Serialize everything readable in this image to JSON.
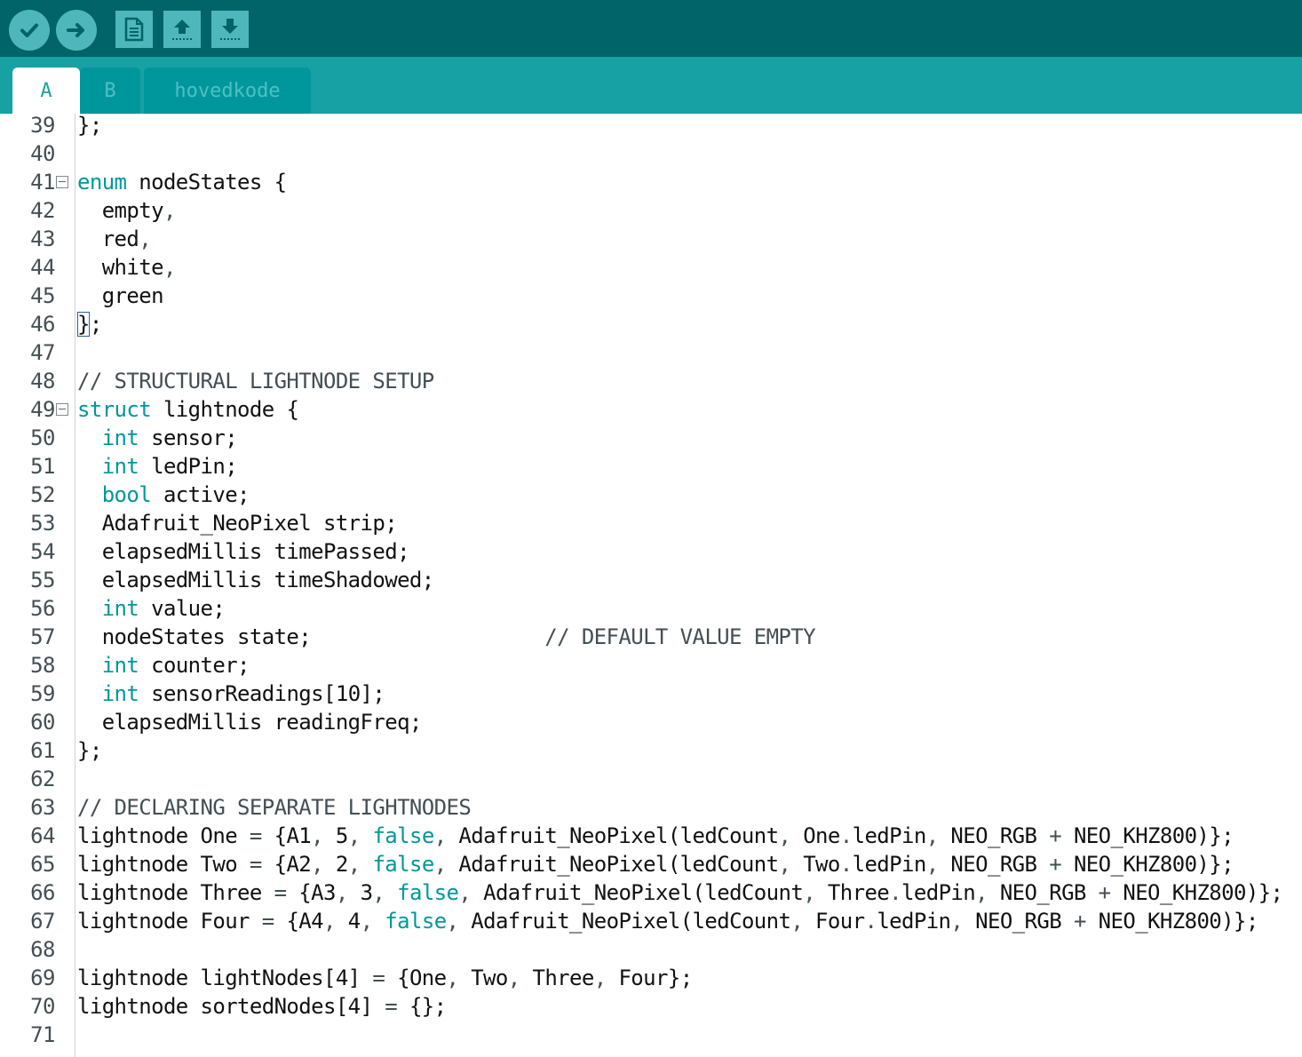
{
  "toolbar": {
    "buttons": [
      {
        "name": "verify-button",
        "icon": "checkmark-icon",
        "shape": "round"
      },
      {
        "name": "upload-button",
        "icon": "arrow-right-icon",
        "shape": "round"
      },
      {
        "name": "new-button",
        "icon": "new-document-icon",
        "shape": "square"
      },
      {
        "name": "open-button",
        "icon": "arrow-up-icon",
        "shape": "square"
      },
      {
        "name": "save-button",
        "icon": "arrow-down-icon",
        "shape": "square"
      }
    ]
  },
  "tabs": [
    {
      "label": "A",
      "active": true
    },
    {
      "label": "B",
      "active": false
    },
    {
      "label": "hovedkode",
      "active": false
    }
  ],
  "colors": {
    "toolbar_bg": "#006468",
    "tabbar_bg": "#17a1a5",
    "keyword": "#00979c",
    "comment": "#434f54"
  },
  "editor": {
    "lines": [
      {
        "n": "39",
        "segments": [
          [
            "t",
            "};"
          ]
        ]
      },
      {
        "n": "40",
        "segments": []
      },
      {
        "n": "41",
        "fold": true,
        "segments": [
          [
            "k",
            "enum"
          ],
          [
            "t",
            " nodeStates {"
          ]
        ]
      },
      {
        "n": "42",
        "segments": [
          [
            "t",
            "  empty"
          ],
          [
            "p",
            ","
          ]
        ]
      },
      {
        "n": "43",
        "segments": [
          [
            "t",
            "  red"
          ],
          [
            "p",
            ","
          ]
        ]
      },
      {
        "n": "44",
        "segments": [
          [
            "t",
            "  white"
          ],
          [
            "p",
            ","
          ]
        ]
      },
      {
        "n": "45",
        "segments": [
          [
            "t",
            "  green"
          ]
        ]
      },
      {
        "n": "46",
        "segments": [
          [
            "b",
            "}"
          ],
          [
            "t",
            ";"
          ]
        ]
      },
      {
        "n": "47",
        "segments": []
      },
      {
        "n": "48",
        "segments": [
          [
            "c",
            "// STRUCTURAL LIGHTNODE SETUP"
          ]
        ]
      },
      {
        "n": "49",
        "fold": true,
        "segments": [
          [
            "k",
            "struct"
          ],
          [
            "t",
            " lightnode {"
          ]
        ]
      },
      {
        "n": "50",
        "segments": [
          [
            "t",
            "  "
          ],
          [
            "k",
            "int"
          ],
          [
            "t",
            " sensor;"
          ]
        ]
      },
      {
        "n": "51",
        "segments": [
          [
            "t",
            "  "
          ],
          [
            "k",
            "int"
          ],
          [
            "t",
            " ledPin;"
          ]
        ]
      },
      {
        "n": "52",
        "segments": [
          [
            "t",
            "  "
          ],
          [
            "k",
            "bool"
          ],
          [
            "t",
            " active;"
          ]
        ]
      },
      {
        "n": "53",
        "segments": [
          [
            "t",
            "  Adafruit_NeoPixel strip;"
          ]
        ]
      },
      {
        "n": "54",
        "segments": [
          [
            "t",
            "  elapsedMillis timePassed;"
          ]
        ]
      },
      {
        "n": "55",
        "segments": [
          [
            "t",
            "  elapsedMillis timeShadowed;"
          ]
        ]
      },
      {
        "n": "56",
        "segments": [
          [
            "t",
            "  "
          ],
          [
            "k",
            "int"
          ],
          [
            "t",
            " value;"
          ]
        ]
      },
      {
        "n": "57",
        "segments": [
          [
            "t",
            "  nodeStates state;                   "
          ],
          [
            "c",
            "// DEFAULT VALUE EMPTY"
          ]
        ]
      },
      {
        "n": "58",
        "segments": [
          [
            "t",
            "  "
          ],
          [
            "k",
            "int"
          ],
          [
            "t",
            " counter;"
          ]
        ]
      },
      {
        "n": "59",
        "segments": [
          [
            "t",
            "  "
          ],
          [
            "k",
            "int"
          ],
          [
            "t",
            " sensorReadings[10];"
          ]
        ]
      },
      {
        "n": "60",
        "segments": [
          [
            "t",
            "  elapsedMillis readingFreq;"
          ]
        ]
      },
      {
        "n": "61",
        "segments": [
          [
            "t",
            "};"
          ]
        ]
      },
      {
        "n": "62",
        "segments": []
      },
      {
        "n": "63",
        "segments": [
          [
            "c",
            "// DECLARING SEPARATE LIGHTNODES"
          ]
        ]
      },
      {
        "n": "64",
        "segments": [
          [
            "t",
            "lightnode One "
          ],
          [
            "p",
            "="
          ],
          [
            "t",
            " {A1"
          ],
          [
            "p",
            ","
          ],
          [
            "t",
            " 5"
          ],
          [
            "p",
            ","
          ],
          [
            "t",
            " "
          ],
          [
            "k",
            "false"
          ],
          [
            "p",
            ","
          ],
          [
            "t",
            " Adafruit_NeoPixel(ledCount"
          ],
          [
            "p",
            ","
          ],
          [
            "t",
            " One"
          ],
          [
            "p",
            "."
          ],
          [
            "t",
            "ledPin"
          ],
          [
            "p",
            ","
          ],
          [
            "t",
            " NEO_RGB "
          ],
          [
            "p",
            "+"
          ],
          [
            "t",
            " NEO_KHZ800)};"
          ]
        ]
      },
      {
        "n": "65",
        "segments": [
          [
            "t",
            "lightnode Two "
          ],
          [
            "p",
            "="
          ],
          [
            "t",
            " {A2"
          ],
          [
            "p",
            ","
          ],
          [
            "t",
            " 2"
          ],
          [
            "p",
            ","
          ],
          [
            "t",
            " "
          ],
          [
            "k",
            "false"
          ],
          [
            "p",
            ","
          ],
          [
            "t",
            " Adafruit_NeoPixel(ledCount"
          ],
          [
            "p",
            ","
          ],
          [
            "t",
            " Two"
          ],
          [
            "p",
            "."
          ],
          [
            "t",
            "ledPin"
          ],
          [
            "p",
            ","
          ],
          [
            "t",
            " NEO_RGB "
          ],
          [
            "p",
            "+"
          ],
          [
            "t",
            " NEO_KHZ800)};"
          ]
        ]
      },
      {
        "n": "66",
        "segments": [
          [
            "t",
            "lightnode Three "
          ],
          [
            "p",
            "="
          ],
          [
            "t",
            " {A3"
          ],
          [
            "p",
            ","
          ],
          [
            "t",
            " 3"
          ],
          [
            "p",
            ","
          ],
          [
            "t",
            " "
          ],
          [
            "k",
            "false"
          ],
          [
            "p",
            ","
          ],
          [
            "t",
            " Adafruit_NeoPixel(ledCount"
          ],
          [
            "p",
            ","
          ],
          [
            "t",
            " Three"
          ],
          [
            "p",
            "."
          ],
          [
            "t",
            "ledPin"
          ],
          [
            "p",
            ","
          ],
          [
            "t",
            " NEO_RGB "
          ],
          [
            "p",
            "+"
          ],
          [
            "t",
            " NEO_KHZ800)};"
          ]
        ]
      },
      {
        "n": "67",
        "segments": [
          [
            "t",
            "lightnode Four "
          ],
          [
            "p",
            "="
          ],
          [
            "t",
            " {A4"
          ],
          [
            "p",
            ","
          ],
          [
            "t",
            " 4"
          ],
          [
            "p",
            ","
          ],
          [
            "t",
            " "
          ],
          [
            "k",
            "false"
          ],
          [
            "p",
            ","
          ],
          [
            "t",
            " Adafruit_NeoPixel(ledCount"
          ],
          [
            "p",
            ","
          ],
          [
            "t",
            " Four"
          ],
          [
            "p",
            "."
          ],
          [
            "t",
            "ledPin"
          ],
          [
            "p",
            ","
          ],
          [
            "t",
            " NEO_RGB "
          ],
          [
            "p",
            "+"
          ],
          [
            "t",
            " NEO_KHZ800)};"
          ]
        ]
      },
      {
        "n": "68",
        "segments": []
      },
      {
        "n": "69",
        "segments": [
          [
            "t",
            "lightnode lightNodes[4] "
          ],
          [
            "p",
            "="
          ],
          [
            "t",
            " {One"
          ],
          [
            "p",
            ","
          ],
          [
            "t",
            " Two"
          ],
          [
            "p",
            ","
          ],
          [
            "t",
            " Three"
          ],
          [
            "p",
            ","
          ],
          [
            "t",
            " Four};"
          ]
        ]
      },
      {
        "n": "70",
        "segments": [
          [
            "t",
            "lightnode sortedNodes[4] "
          ],
          [
            "p",
            "="
          ],
          [
            "t",
            " {};"
          ]
        ]
      },
      {
        "n": "71",
        "segments": []
      }
    ]
  }
}
